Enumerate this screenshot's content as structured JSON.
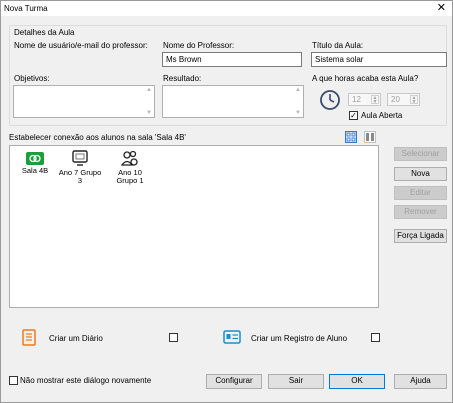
{
  "window": {
    "title": "Nova Turma",
    "close_glyph": "✕"
  },
  "details": {
    "group_title": "Detalhes da Aula",
    "teacher_user_label": "Nome de usuário/e-mail do professor:",
    "teacher_name_label": "Nome do Professor:",
    "teacher_name_value": "Ms Brown",
    "class_title_label": "Título da Aula:",
    "class_title_value": "Sistema solar",
    "objectives_label": "Objetivos:",
    "result_label": "Resultado:",
    "end_time_label": "A que horas acaba esta Aula?",
    "hour_value": "12",
    "minute_value": "20",
    "open_class_label": "Aula Aberta",
    "open_class_checked": "✓"
  },
  "connect": {
    "label": "Estabelecer conexão aos alunos na sala 'Sala 4B'",
    "items": [
      {
        "label": "Sala 4B",
        "icon": "room-icon"
      },
      {
        "label": "Ano 7 Grupo 3",
        "icon": "monitor-icon"
      },
      {
        "label": "Ano 10 Grupo 1",
        "icon": "people-icon"
      }
    ]
  },
  "side_buttons": {
    "select": "Selecionar",
    "new": "Nova",
    "edit": "Editar",
    "remove": "Remover",
    "force": "Força Ligada"
  },
  "options": {
    "diary": "Criar um Diário",
    "student_record": "Criar um Registro de Aluno",
    "dont_show": "Não mostrar este diálogo novamente"
  },
  "footer": {
    "configure": "Configurar",
    "exit": "Sair",
    "ok": "OK",
    "help": "Ajuda"
  },
  "colors": {
    "accent": "#0078d7",
    "green": "#1e9e3a",
    "orange": "#e97a1f",
    "teal": "#1b8fc8"
  }
}
